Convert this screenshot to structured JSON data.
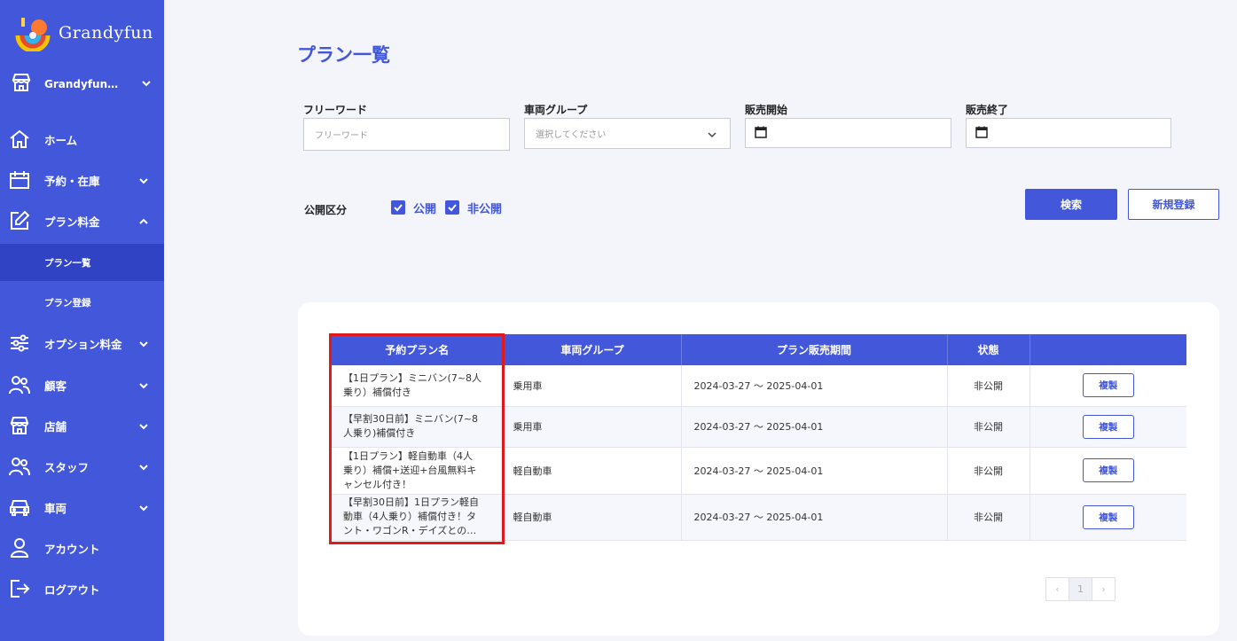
{
  "sidebar": {
    "brand": "Grandyfun",
    "store": "Grandyfun…",
    "items": [
      {
        "label": "ホーム",
        "icon": "home-icon"
      },
      {
        "label": "予約・在庫",
        "icon": "calendar-icon"
      },
      {
        "label": "プラン料金",
        "icon": "edit-icon"
      },
      {
        "label": "オプション料金",
        "icon": "sliders-icon"
      },
      {
        "label": "顧客",
        "icon": "users-icon"
      },
      {
        "label": "店舗",
        "icon": "store-icon"
      },
      {
        "label": "スタッフ",
        "icon": "staff-icon"
      },
      {
        "label": "車両",
        "icon": "car-icon"
      },
      {
        "label": "アカウント",
        "icon": "user-icon"
      },
      {
        "label": "ログアウト",
        "icon": "logout-icon"
      }
    ],
    "subitems": [
      {
        "label": "プラン一覧"
      },
      {
        "label": "プラン登録"
      }
    ]
  },
  "page": {
    "title": "プラン一覧"
  },
  "filters": {
    "freeword": {
      "label": "フリーワード",
      "placeholder": "フリーワード"
    },
    "vehicle_group": {
      "label": "車両グループ",
      "placeholder": "選択してください"
    },
    "sale_start": {
      "label": "販売開始"
    },
    "sale_end": {
      "label": "販売終了"
    },
    "visibility": {
      "label": "公開区分",
      "public": "公開",
      "private": "非公開"
    }
  },
  "buttons": {
    "search": "検索",
    "new": "新規登録"
  },
  "table": {
    "headers": [
      "予約プラン名",
      "車両グループ",
      "プラン販売期間",
      "状態",
      ""
    ],
    "rows": [
      {
        "name_line1": "【1日プラン】ミニバン(7~8人",
        "name_line2": "乗り）補償付き",
        "name_line3": "",
        "group": "乗用車",
        "period": "2024-03-27 ～ 2025-04-01",
        "status": "非公開",
        "action": "複製"
      },
      {
        "name_line1": "【早割30日前】ミニバン(7~8",
        "name_line2": "人乗り)補償付き",
        "name_line3": "",
        "group": "乗用車",
        "period": "2024-03-27 ～ 2025-04-01",
        "status": "非公開",
        "action": "複製"
      },
      {
        "name_line1": "【1日プラン】軽自動車（4人",
        "name_line2": "乗り）補償+送迎+台風無料キ",
        "name_line3": "ャンセル付き！",
        "group": "軽自動車",
        "period": "2024-03-27 ～ 2025-04-01",
        "status": "非公開",
        "action": "複製"
      },
      {
        "name_line1": "【早割30日前】1日プラン軽自",
        "name_line2": "動車（4人乗り）補償付き！タ",
        "name_line3": "ント・ワゴンR・デイズとの…",
        "group": "軽自動車",
        "period": "2024-03-27 ～ 2025-04-01",
        "status": "非公開",
        "action": "複製"
      }
    ]
  },
  "pagination": {
    "current": "1",
    "prev": "‹",
    "next": "›"
  }
}
